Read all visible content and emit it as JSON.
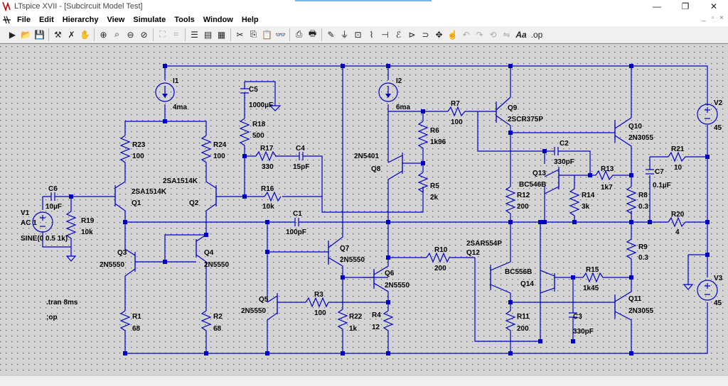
{
  "window": {
    "title": "LTspice XVII - [Subcircuit Model  Test]"
  },
  "menu": [
    "File",
    "Edit",
    "Hierarchy",
    "View",
    "Simulate",
    "Tools",
    "Window",
    "Help"
  ],
  "toolbar_icons": [
    "run-icon",
    "open-icon",
    "save-icon",
    "control-panel-icon",
    "halt-icon",
    "pan-icon",
    "zoom-in-icon",
    "zoom-pan-icon",
    "zoom-out-icon",
    "zoom-fit-icon",
    "autoscale-icon",
    "grid-icon",
    "tile-icon",
    "cascade-icon",
    "close-all-icon",
    "cut-icon",
    "copy-icon",
    "paste-icon",
    "find-icon",
    "print-setup-icon",
    "print-icon",
    "wire-icon",
    "ground-icon",
    "label-icon",
    "resistor-icon",
    "capacitor-icon",
    "inductor-icon",
    "diode-icon",
    "component-icon",
    "move-icon",
    "drag-icon",
    "undo-icon",
    "redo-icon",
    "rotate-icon",
    "mirror-icon",
    "text-icon",
    "spice-directive-icon"
  ],
  "schematic": {
    "labels": {
      "I1": "I1",
      "I1v": "4ma",
      "I2": "I2",
      "I2v": "6ma",
      "C5": "C5",
      "C5v": "1000µF",
      "R18": "R18",
      "R18v": "500",
      "R17": "R17",
      "R17v": "330",
      "C4": "C4",
      "C4v": "15pF",
      "R16": "R16",
      "R16v": "10k",
      "R23": "R23",
      "R23v": "100",
      "R24": "R24",
      "R24v": "100",
      "Q1m": "2SA1514K",
      "Q1": "Q1",
      "Q2m": "2SA1514K",
      "Q2": "Q2",
      "C6": "C6",
      "C6v": "10µF",
      "R19": "R19",
      "R19v": "10k",
      "V1": "V1",
      "V1a": "AC 1",
      "V1s": "SINE(0 0.5 1k)",
      "C1": "C1",
      "C1v": "100pF",
      "Q3": "Q3",
      "Q3m": "2N5550",
      "Q4": "Q4",
      "Q4m": "2N5550",
      "Q7": "Q7",
      "Q7m": "2N5550",
      "Q6": "Q6",
      "Q6m": "2N5550",
      "Q5": "Q5",
      "Q5m": "2N5550",
      "R3": "R3",
      "R3v": "100",
      "R22": "R22",
      "R22v": "1k",
      "R4": "R4",
      "R4v": "12",
      "R1": "R1",
      "R1v": "68",
      "R2": "R2",
      "R2v": "68",
      "tran": ".tran 8ms",
      "op": ";op",
      "R7": "R7",
      "R7v": "100",
      "Q9": "Q9",
      "Q9m": "2SCR375P",
      "R6": "R6",
      "R6v": "1k96",
      "Q8m": "2N5401",
      "Q8": "Q8",
      "R5": "R5",
      "R5v": "2k",
      "R10": "R10",
      "R10v": "200",
      "Q12m": "2SAR554P",
      "Q12": "Q12",
      "C2": "C2",
      "C2v": "330pF",
      "R13": "R13",
      "R13v": "1k7",
      "Q13": "Q13",
      "Q13m": "BC546B",
      "R14": "R14",
      "R14v": "3k",
      "R12": "R12",
      "R12v": "200",
      "Q14m": "BC556B",
      "Q14": "Q14",
      "R15": "R15",
      "R15v": "1k45",
      "R11": "R11",
      "R11v": "200",
      "C3": "C3",
      "C3v": "330pF",
      "Q10": "Q10",
      "Q10m": "2N3055",
      "Q11": "Q11",
      "Q11m": "2N3055",
      "R8": "R8",
      "R8v": "0.3",
      "R9": "R9",
      "R9v": "0.3",
      "C7": "C7",
      "C7v": "0.1µF",
      "R21": "R21",
      "R21v": "10",
      "R20": "R20",
      "R20v": "4",
      "V2": "V2",
      "V2v": "45",
      "V3": "V3",
      "V3v": "45"
    }
  }
}
